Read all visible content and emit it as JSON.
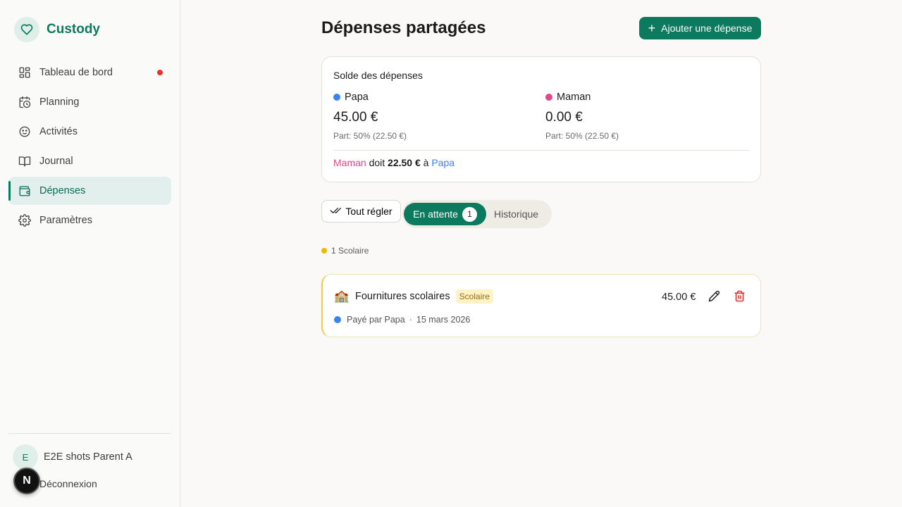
{
  "app": {
    "name": "Custody",
    "brand_color": "#0b7a5f"
  },
  "sidebar": {
    "items": [
      {
        "label": "Tableau de bord",
        "icon": "dashboard-icon",
        "has_notification": true
      },
      {
        "label": "Planning",
        "icon": "calendar-clock-icon"
      },
      {
        "label": "Activités",
        "icon": "smile-icon"
      },
      {
        "label": "Journal",
        "icon": "book-open-icon"
      },
      {
        "label": "Dépenses",
        "icon": "wallet-icon",
        "active": true
      },
      {
        "label": "Paramètres",
        "icon": "gear-icon"
      }
    ],
    "user": {
      "initial": "E",
      "name": "E2E shots Parent A"
    },
    "logout_label": "Déconnexion",
    "dev_badge": "N"
  },
  "main": {
    "title": "Dépenses partagées",
    "add_button_label": "Ajouter une dépense",
    "balance": {
      "title": "Solde des dépenses",
      "papa": {
        "name": "Papa",
        "amount": "45.00 €",
        "share": "Part: 50% (22.50 €)",
        "color": "#3b82f6"
      },
      "maman": {
        "name": "Maman",
        "amount": "0.00 €",
        "share": "Part: 50% (22.50 €)",
        "color": "#e2478a"
      },
      "owed": {
        "debtor": "Maman",
        "verb": "doit",
        "amount": "22.50 €",
        "prep": "à",
        "creditor": "Papa"
      }
    },
    "settle_label": "Tout régler",
    "tabs": {
      "pending_label": "En attente",
      "pending_count": "1",
      "history_label": "Historique"
    },
    "category_summary": "1 Scolaire",
    "expense": {
      "emoji": "🏫",
      "title": "Fournitures scolaires",
      "tag": "Scolaire",
      "paid_by": "Payé par Papa",
      "separator": "·",
      "date": "15 mars 2026",
      "amount": "45.00 €"
    }
  }
}
